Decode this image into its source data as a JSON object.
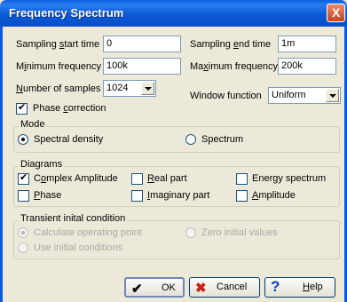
{
  "window": {
    "title": "Frequency Spectrum",
    "close_glyph": "X"
  },
  "fields": {
    "sampling_start_time": {
      "label_pre": "Sampling ",
      "label_u": "s",
      "label_post": "tart time",
      "value": "0"
    },
    "sampling_end_time": {
      "label_pre": "Sampling ",
      "label_u": "e",
      "label_post": "nd time",
      "value": "1m"
    },
    "minimum_frequency": {
      "label_pre": "M",
      "label_u": "i",
      "label_post": "nimum frequency",
      "value": "100k"
    },
    "maximum_frequency": {
      "label_pre": "Ma",
      "label_u": "x",
      "label_post": "imum frequency",
      "value": "200k"
    },
    "number_of_samples": {
      "label_pre": "",
      "label_u": "N",
      "label_post": "umber of samples",
      "value": "1024"
    },
    "window_function": {
      "label": "Window function",
      "value": "Uniform"
    },
    "phase_correction": {
      "label_pre": "Phase ",
      "label_u": "c",
      "label_post": "orrection",
      "checked": true
    }
  },
  "mode": {
    "title": "Mode",
    "options": [
      {
        "label": "Spectral density",
        "checked": true
      },
      {
        "label": "Spectrum",
        "checked": false
      }
    ]
  },
  "diagrams": {
    "title": "Diagrams",
    "items": [
      {
        "label_pre": "C",
        "label_u": "o",
        "label_post": "mplex Amplitude",
        "checked": true
      },
      {
        "label_pre": "",
        "label_u": "R",
        "label_post": "eal part",
        "checked": false
      },
      {
        "label_pre": "Ener",
        "label_u": "g",
        "label_post": "y spectrum",
        "checked": false
      },
      {
        "label_pre": "",
        "label_u": "P",
        "label_post": "hase",
        "checked": false
      },
      {
        "label_pre": "",
        "label_u": "I",
        "label_post": "maginary part",
        "checked": false
      },
      {
        "label_pre": "",
        "label_u": "A",
        "label_post": "mplitude",
        "checked": false
      }
    ]
  },
  "transient": {
    "title": "Transient inital condition",
    "options": [
      {
        "label": "Calculate operating point",
        "checked": true
      },
      {
        "label": "Zero initial values",
        "checked": false
      },
      {
        "label": "Use initial conditions",
        "checked": false
      }
    ]
  },
  "buttons": {
    "ok": {
      "label": "OK",
      "icon": "check-icon"
    },
    "cancel": {
      "label": "Cancel",
      "icon": "x-icon"
    },
    "help": {
      "label_u": "H",
      "label_post": "elp",
      "icon": "question-icon"
    }
  }
}
